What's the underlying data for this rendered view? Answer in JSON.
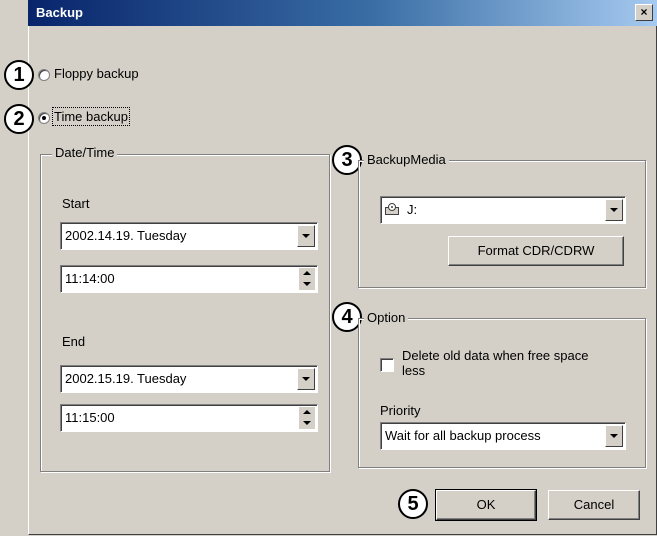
{
  "window": {
    "title": "Backup",
    "close_glyph": "×"
  },
  "mode": {
    "floppy_label": "Floppy backup",
    "time_label": "Time backup",
    "selected": "time"
  },
  "datetime": {
    "group_label": "Date/Time",
    "start_label": "Start",
    "start_date": "2002.14.19.  Tuesday",
    "start_time": "11:14:00",
    "end_label": "End",
    "end_date": "2002.15.19.  Tuesday",
    "end_time": "11:15:00"
  },
  "media": {
    "group_label": "BackupMedia",
    "drive": "J:",
    "format_button": "Format CDR/CDRW"
  },
  "option": {
    "group_label": "Option",
    "delete_old_label": "Delete old data when free space less",
    "delete_old_checked": false,
    "priority_label": "Priority",
    "priority_value": "Wait for all backup process"
  },
  "buttons": {
    "ok": "OK",
    "cancel": "Cancel"
  },
  "callouts": [
    "1",
    "2",
    "3",
    "4",
    "5"
  ],
  "icons": {
    "drive": "cd-drive-icon",
    "close": "close-icon",
    "dropdown": "chevron-down-icon",
    "spinner": "spin-arrows-icon"
  },
  "colors": {
    "title_bar_start": "#08246b",
    "title_bar_end": "#a6caf0",
    "dialog_background": "#d4d0c8"
  }
}
